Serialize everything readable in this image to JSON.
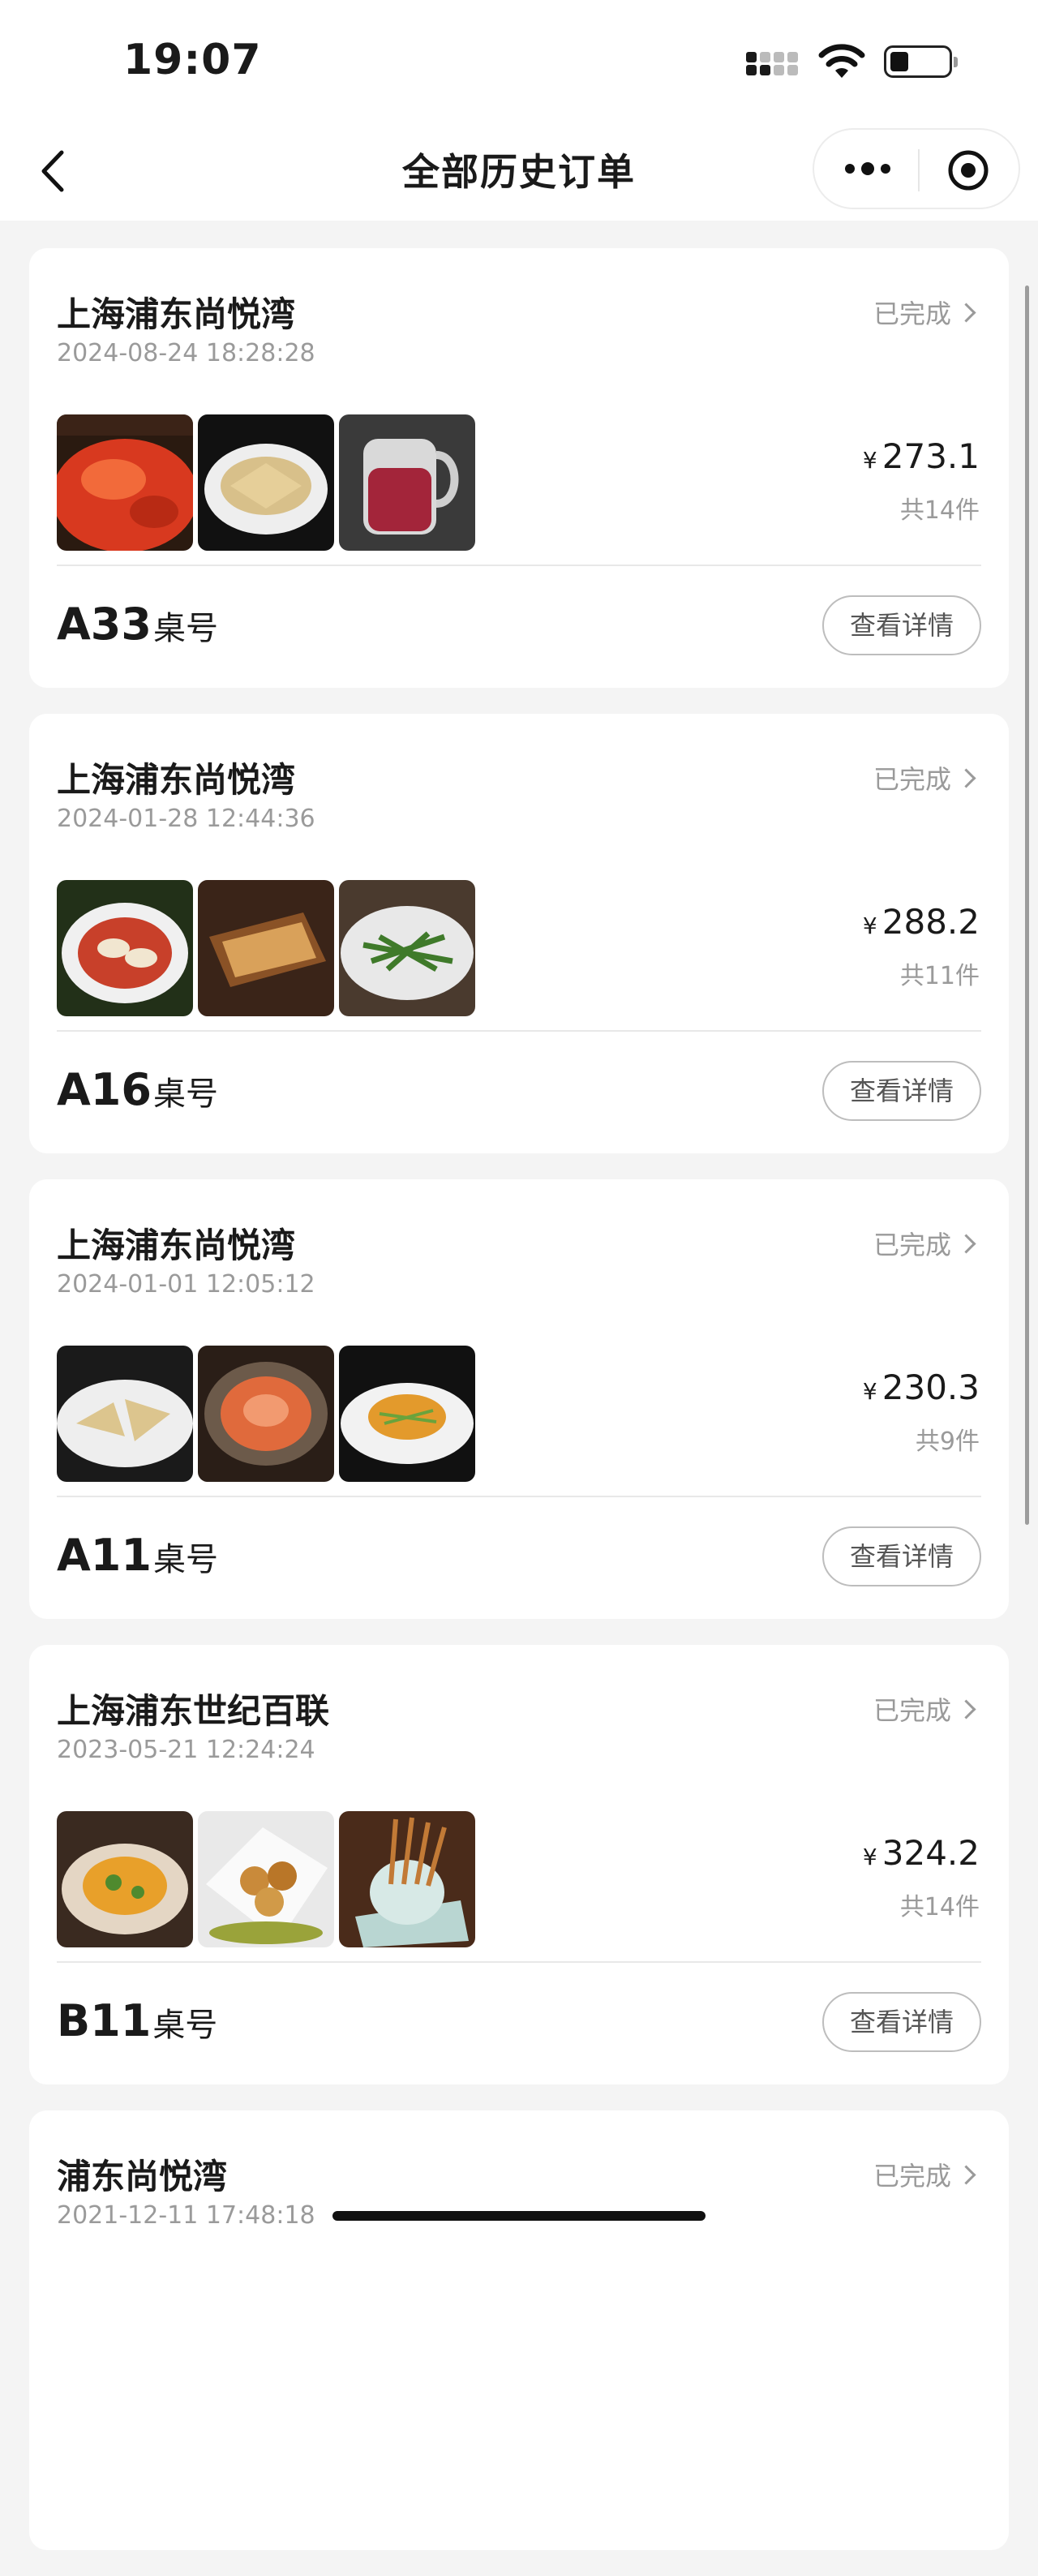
{
  "status_bar": {
    "time": "19:07"
  },
  "nav": {
    "title": "全部历史订单"
  },
  "orders": [
    {
      "store": "上海浦东尚悦湾",
      "datetime": "2024-08-24 18:28:28",
      "status": "已完成",
      "currency": "¥",
      "price": "273.1",
      "count": "共14件",
      "table": "A33",
      "table_label": "桌号",
      "detail": "查看详情",
      "thumbs": [
        "chili-fish-dish",
        "dumplings-plate",
        "juice-pitcher"
      ]
    },
    {
      "store": "上海浦东尚悦湾",
      "datetime": "2024-01-28 12:44:36",
      "status": "已完成",
      "currency": "¥",
      "price": "288.2",
      "count": "共11件",
      "table": "A16",
      "table_label": "桌号",
      "detail": "查看详情",
      "thumbs": [
        "wontons-chili-oil",
        "fried-dumplings-basket",
        "green-beans-stirfry"
      ]
    },
    {
      "store": "上海浦东尚悦湾",
      "datetime": "2024-01-01 12:05:12",
      "status": "已完成",
      "currency": "¥",
      "price": "230.3",
      "count": "共9件",
      "table": "A11",
      "table_label": "桌号",
      "detail": "查看详情",
      "thumbs": [
        "dumplings-plate",
        "sliced-meat-chili",
        "shredded-potato"
      ]
    },
    {
      "store": "上海浦东世纪百联",
      "datetime": "2023-05-21 12:24:24",
      "status": "已完成",
      "currency": "¥",
      "price": "324.2",
      "count": "共14件",
      "table": "B11",
      "table_label": "桌号",
      "detail": "查看详情",
      "thumbs": [
        "egg-tomato-dish",
        "fried-balls",
        "skewers-pot"
      ]
    },
    {
      "store": "浦东尚悦湾",
      "datetime": "2021-12-11 17:48:18",
      "status": "已完成"
    }
  ]
}
